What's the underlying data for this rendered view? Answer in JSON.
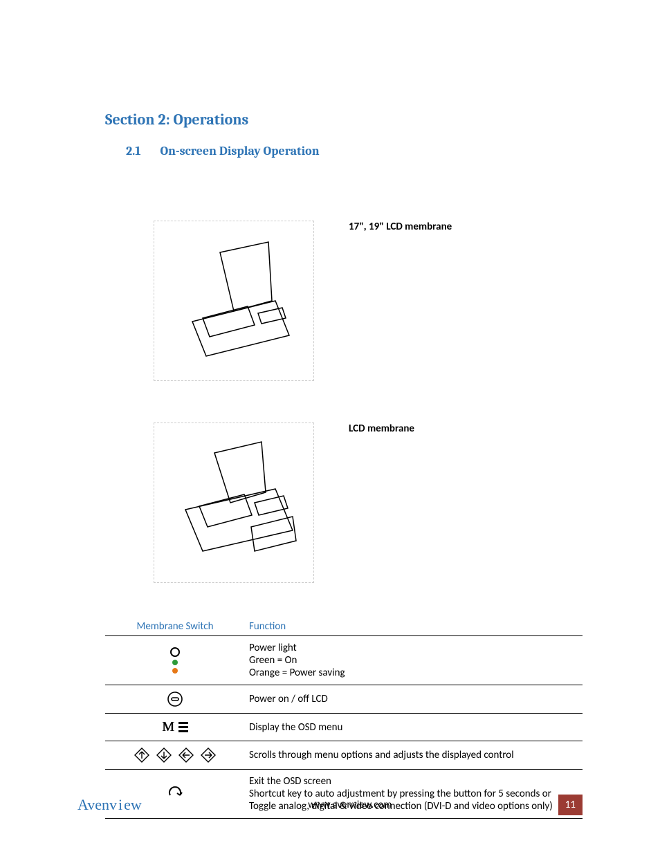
{
  "section": {
    "title": "Section 2: Operations",
    "sub_number": "2.1",
    "sub_title": "On-screen Display Operation"
  },
  "figures": [
    {
      "caption": "17\", 19\" LCD membrane",
      "alt": "LCD console drawing 17/19 inch"
    },
    {
      "caption": "LCD membrane",
      "alt": "LCD console drawing"
    }
  ],
  "table": {
    "header_switch": "Membrane Switch",
    "header_function": "Function",
    "rows": [
      {
        "switch_icon": "power-indicator",
        "function_lines": [
          "Power light",
          "Green = On",
          "Orange = Power saving"
        ]
      },
      {
        "switch_icon": "power-button",
        "function_lines": [
          "Power on / off LCD"
        ]
      },
      {
        "switch_icon": "menu-button",
        "function_lines": [
          "Display the OSD menu"
        ]
      },
      {
        "switch_icon": "arrows",
        "function_lines": [
          "Scrolls through menu options and adjusts the displayed control"
        ]
      },
      {
        "switch_icon": "exit-auto",
        "function_lines": [
          "Exit the OSD screen",
          "Shortcut key to auto adjustment by pressing the button for 5 seconds or",
          "Toggle analog, digital & video connection (DVI-D and video options only)"
        ]
      }
    ]
  },
  "footer": {
    "logo": "Avenview",
    "url": "www.avenview.com",
    "page": "11"
  }
}
